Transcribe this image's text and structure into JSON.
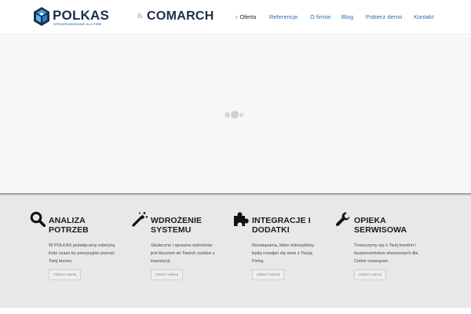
{
  "header": {
    "logo": {
      "brand": "POLKAS",
      "tagline": "OPROGRAMOWANIE DLA FIRM",
      "amp": "&",
      "partner": "COMARCH"
    },
    "nav": [
      {
        "label": "Oferta",
        "active": true
      },
      {
        "label": "Referencje",
        "active": false
      },
      {
        "label": "O firmie",
        "active": false
      },
      {
        "label": "Blog",
        "active": false
      },
      {
        "label": "Pobierz demo",
        "active": false
      },
      {
        "label": "Kontakt",
        "active": false
      }
    ]
  },
  "hero": {
    "loader_icon": "loading-dots"
  },
  "features": [
    {
      "icon": "search-icon",
      "title_line1": "ANALIZA",
      "title_line2": "POTRZEB",
      "text_line1": "W POLKAS poświęcamy należytą",
      "text_line2": "ilość czasu by precyzyjnie poznać",
      "text_line3": "Twój biznes.",
      "button": "Zobacz więcej"
    },
    {
      "icon": "magic-wand-icon",
      "title_line1": "WDROŻENIE",
      "title_line2": "SYSTEMU",
      "text_line1": "Skuteczne i sprawne wdrożenie",
      "text_line2": "jest kluczem do Twoich zysków z",
      "text_line3": "inwestycji.",
      "button": "Zobacz więcej"
    },
    {
      "icon": "puzzle-icon",
      "title_line1": "INTEGRACJE I",
      "title_line2": "DODATKI",
      "text_line1": "Rozwiązania, które wdrożyliśmy",
      "text_line2": "będą rozwijać się wraz z Twoją",
      "text_line3": "Firmą.",
      "button": "Zobacz więcej"
    },
    {
      "icon": "wrench-icon",
      "title_line1": "OPIEKA",
      "title_line2": "SERWISOWA",
      "text_line1": "Troszczymy się o Twój komfort i",
      "text_line2": "bezpieczeństwo stworzonych dla",
      "text_line3": "Ciebie rozwiązań.",
      "button": "Zobacz więcej"
    }
  ],
  "colors": {
    "nav_link": "#2c6fb0",
    "brand_dark": "#1d2e4a",
    "features_bg": "#e8e8e8",
    "hero_bg": "#f7f7f7"
  }
}
